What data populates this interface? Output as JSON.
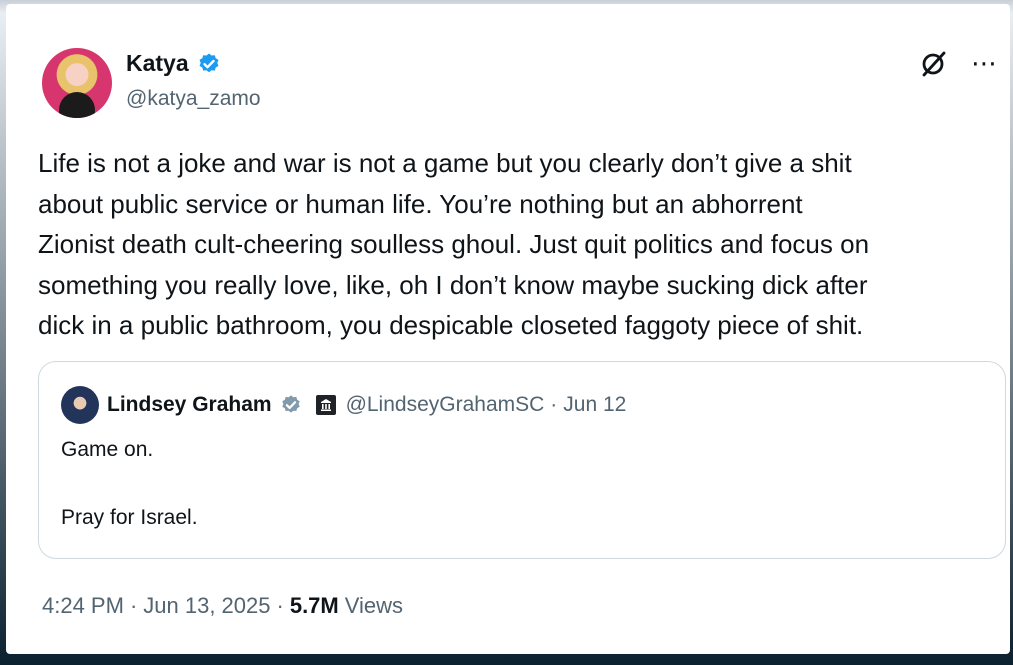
{
  "author": {
    "name": "Katya",
    "handle": "@katya_zamo",
    "verified": true
  },
  "tweet": {
    "text": "Life is not a joke and war is not a game but you clearly don’t give a shit\nabout public service or human life. You’re nothing but an abhorrent\nZionist death cult-cheering soulless ghoul. Just quit politics and focus on\nsomething you really love,  like, oh I don’t know maybe sucking dick after\ndick in a public bathroom, you despicable closeted faggoty piece of shit."
  },
  "quoted": {
    "name": "Lindsey Graham",
    "handle": "@LindseyGrahamSC",
    "separator": "·",
    "date": "Jun 12",
    "lines": [
      "Game on.",
      "Pray for Israel."
    ]
  },
  "footer": {
    "time": "4:24 PM",
    "sep1": "·",
    "date": "Jun 13, 2025",
    "sep2": "·",
    "views_count": "5.7M",
    "views_label": "Views"
  },
  "icons": {
    "verified_badge": "verified-badge-icon",
    "grok": "grok-icon",
    "more": "more-icon",
    "government": "government-building-icon"
  },
  "colors": {
    "verified_blue": "#1d9bf0",
    "gov_gray": "#829aab",
    "text_primary": "#0f1419",
    "text_secondary": "#536471",
    "border": "#cfd9de"
  }
}
